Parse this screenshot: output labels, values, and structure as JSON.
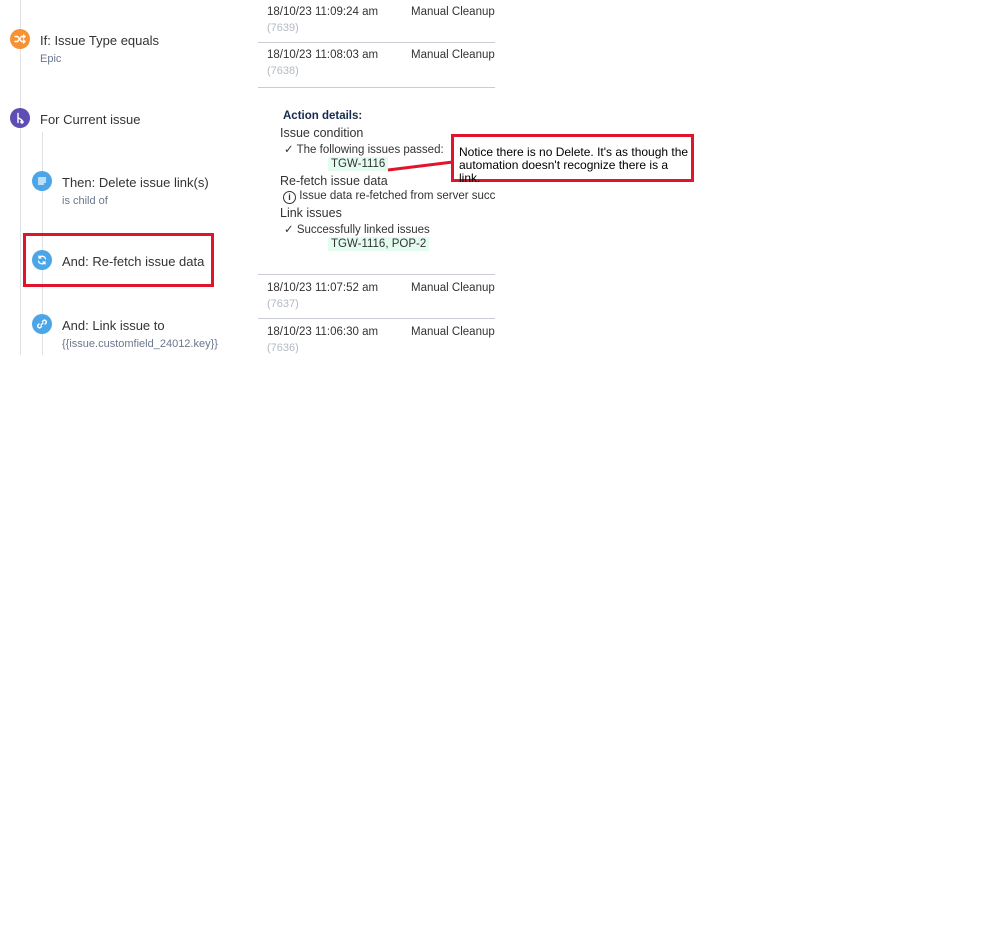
{
  "rule_steps": [
    {
      "title": "If: Issue Type equals",
      "subtitle": "Epic",
      "icon": "shuffle-icon",
      "color": "#f79232"
    },
    {
      "title": "For Current issue",
      "subtitle": "",
      "icon": "branch-icon",
      "color": "#5e4db2"
    },
    {
      "title": "Then: Delete issue link(s)",
      "subtitle": "is child of",
      "icon": "list-icon",
      "color": "#4ba6e8"
    },
    {
      "title": "And: Re-fetch issue data",
      "subtitle": "",
      "icon": "refresh-icon",
      "color": "#4ba6e8"
    },
    {
      "title": "And: Link issue to",
      "subtitle": "{{issue.customfield_24012.key}}",
      "icon": "link-icon",
      "color": "#4ba6e8"
    }
  ],
  "audit_log": [
    {
      "date": "18/10/23 11:09:24 am",
      "status": "Manual Cleanup",
      "id": "(7639)"
    },
    {
      "date": "18/10/23 11:08:03 am",
      "status": "Manual Cleanup",
      "id": "(7638)"
    },
    {
      "date": "18/10/23 11:07:52 am",
      "status": "Manual Cleanup",
      "id": "(7637)"
    },
    {
      "date": "18/10/23 11:06:30 am",
      "status": "Manual Cleanup",
      "id": "(7636)"
    }
  ],
  "action_details": {
    "heading": "Action details:",
    "issue_condition": "Issue condition",
    "passed_text": "The following issues passed:",
    "passed_issues": "TGW-1116",
    "refetch": "Re-fetch issue data",
    "refetch_text": "Issue data re-fetched from server succe",
    "link_issues": "Link issues",
    "linked_text": "Successfully linked issues",
    "linked_issues": "TGW-1116, POP-2"
  },
  "annotation": {
    "line1": "Notice there is no Delete.  It's as though the",
    "line2": "automation doesn't recognize there is a link.",
    "color": "#e0142a"
  }
}
